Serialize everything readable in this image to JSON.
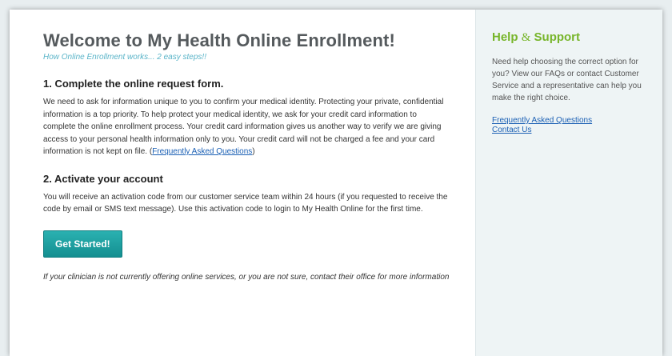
{
  "main": {
    "title": "Welcome to My Health Online Enrollment!",
    "subtitle": "How Online Enrollment works... 2 easy steps!!",
    "step1": {
      "heading": "1. Complete the online request form.",
      "body": "We need to ask for information unique to you to confirm your medical identity. Protecting your private, confidential information is a top priority. To help protect your medical identity, we ask for your credit card information to complete the online enrollment process. Your credit card information gives us another way to verify we are giving access to your personal health information only to you. Your credit card will not be charged a fee and your card information is not kept on file. (",
      "link": "Frequently Asked Questions",
      "after": ")"
    },
    "step2": {
      "heading": "2. Activate your account",
      "body": "You will receive an activation code from our customer service team within 24 hours (if you requested to receive the code by email or SMS text message). Use this activation code to login to My Health Online for the first time."
    },
    "button_label": "Get Started!",
    "note": "If your clinician is not currently offering online services, or you are not sure, contact their office for more information"
  },
  "sidebar": {
    "title_help": "Help",
    "title_amp": "&",
    "title_support": "Support",
    "text": "Need help choosing the correct option for you? View our FAQs or contact Customer Service and a representative can help you make the right choice.",
    "links": [
      "Frequently Asked Questions",
      "Contact Us"
    ]
  },
  "colors": {
    "accent_green": "#77b52a",
    "button_teal": "#1fa3a4",
    "subtitle_blue": "#5ab4c8",
    "link_blue": "#1a5fb4"
  }
}
